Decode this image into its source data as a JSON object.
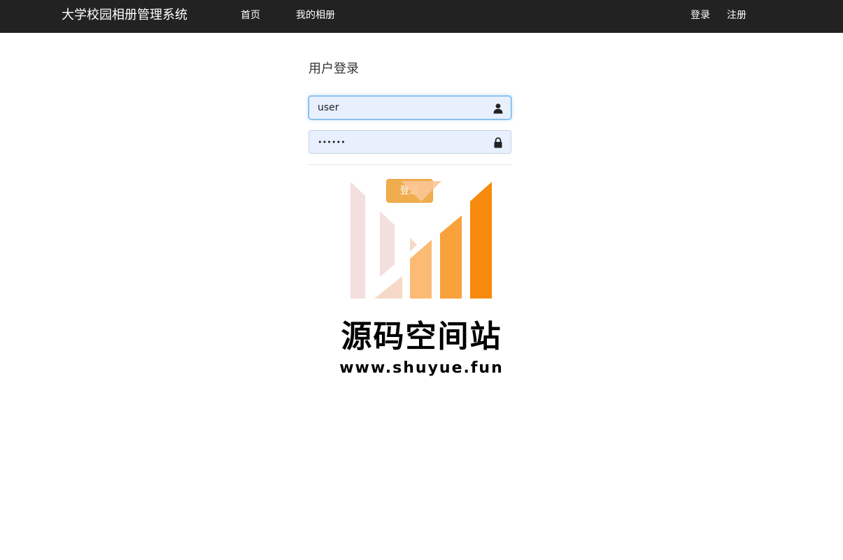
{
  "navbar": {
    "brand": "大学校园相册管理系统",
    "links": {
      "home": "首页",
      "my_albums": "我的相册",
      "login": "登录",
      "register": "注册"
    }
  },
  "login_form": {
    "title": "用户登录",
    "username_value": "user",
    "password_value": "••••••",
    "submit_label": "登录"
  },
  "watermark": {
    "title": "源码空间站",
    "url": "www.shuyue.fun"
  },
  "colors": {
    "navbar_bg": "#222222",
    "input_bg": "#e8f0fe",
    "button_warning": "#f0ad4e",
    "logo_orange": "#f7890c"
  },
  "icons": {
    "username_field": "user-icon",
    "password_field": "lock-icon"
  }
}
